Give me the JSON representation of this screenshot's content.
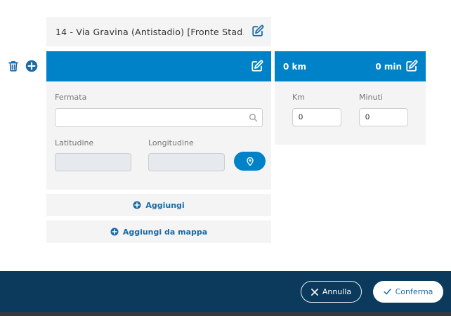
{
  "stop": {
    "title": "14 - Via Gravina (Antistadio) [Fronte Stad..."
  },
  "form": {
    "fermata_label": "Fermata",
    "fermata_value": "",
    "latitudine_label": "Latitudine",
    "longitudine_label": "Longitudine",
    "add_label": "Aggiungi",
    "add_map_label": "Aggiungi da mappa"
  },
  "distance": {
    "km_display": "0 km",
    "min_display": "0 min",
    "km_label": "Km",
    "minuti_label": "Minuti",
    "km_value": "0",
    "minuti_value": "0"
  },
  "footer": {
    "annulla": "Annulla",
    "conferma": "Conferma"
  },
  "colors": {
    "primary": "#0082c8",
    "footer": "#0b3a5c",
    "panel": "#f4f4f4",
    "link": "#1a6aa6"
  },
  "icons": [
    "edit-icon",
    "trash-icon",
    "plus-circle-icon",
    "search-icon",
    "map-pin-icon",
    "close-icon",
    "check-icon"
  ]
}
